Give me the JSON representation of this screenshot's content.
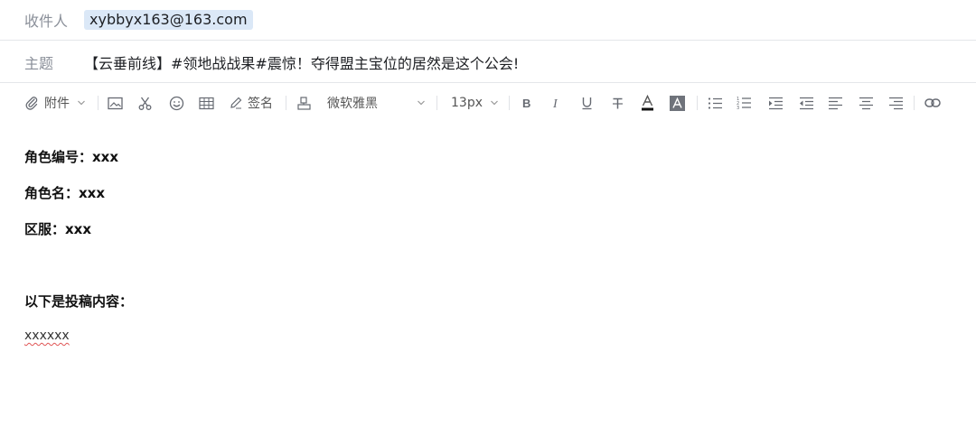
{
  "header": {
    "to_label": "收件人",
    "to_value": "xybbyx163@163.com",
    "subject_label": "主题",
    "subject_value": "【云垂前线】#领地战战果#震惊！夺得盟主宝位的居然是这个公会!"
  },
  "toolbar": {
    "attachment_label": "附件",
    "signature_label": "签名",
    "font_family_value": "微软雅黑",
    "font_size_value": "13px",
    "icons": [
      "paperclip-icon",
      "chevron-down-icon",
      "image-icon",
      "scissors-icon",
      "emoji-icon",
      "table-icon",
      "pen-icon",
      "stamp-icon",
      "bold-icon",
      "italic-icon",
      "underline-icon",
      "strikethrough-icon",
      "font-color-icon",
      "highlight-icon",
      "bullet-list-icon",
      "numbered-list-icon",
      "indent-icon",
      "outdent-icon",
      "align-left-icon",
      "align-center-icon",
      "align-right-icon",
      "link-icon"
    ]
  },
  "body": {
    "line1": "角色编号：xxx",
    "line2": "角色名：xxx",
    "line3": "区服：xxx",
    "line4": "以下是投稿内容：",
    "line5": "xxxxxx"
  },
  "colors": {
    "chip_bg": "#dbe8f7",
    "label_gray": "#8a8f99",
    "spell_error": "#e05555"
  }
}
